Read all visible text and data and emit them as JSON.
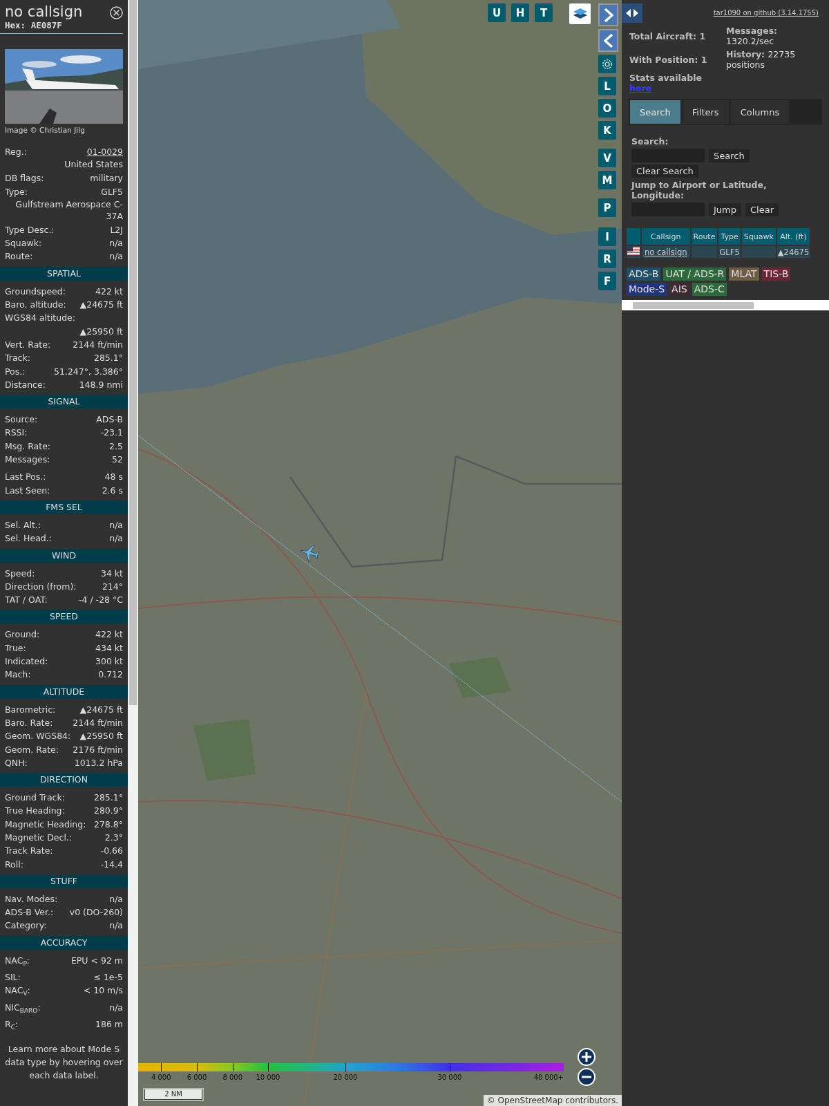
{
  "detail": {
    "callsign": "no callsign",
    "hex": "Hex: AE087F",
    "photo_credit": "Image © Christian Jilg",
    "rows": [
      {
        "label": "Reg.:",
        "value": "01-0029",
        "kind": "link"
      },
      {
        "value": "United States",
        "kind": "value_only"
      },
      {
        "label": "DB flags:",
        "value": "military",
        "kind": "pair"
      },
      {
        "label": "Type:",
        "value": "GLF5",
        "kind": "pair"
      },
      {
        "value": "Gulfstream Aerospace C-37A",
        "kind": "value_only"
      },
      {
        "label": "Type Desc.:",
        "value": "L2J",
        "kind": "pair"
      },
      {
        "label": "Squawk:",
        "value": "n/a",
        "kind": "pair"
      },
      {
        "label": "Route:",
        "value": "n/a",
        "kind": "pair"
      }
    ],
    "sections": [
      {
        "title": "SPATIAL",
        "groups": [
          [
            {
              "label": "Groundspeed:",
              "value": "422 kt",
              "kind": "pair"
            },
            {
              "label": "Baro. altitude:",
              "value": "▲24675 ft",
              "kind": "pair"
            },
            {
              "label": "WGS84 altitude:",
              "value": "▲25950 ft",
              "kind": "stacked"
            },
            {
              "label": "Vert. Rate:",
              "value": "2144 ft/min",
              "kind": "pair"
            },
            {
              "label": "Track:",
              "value": "285.1°",
              "kind": "pair"
            },
            {
              "label": "Pos.:",
              "value": "51.247°, 3.386°",
              "kind": "pair"
            },
            {
              "label": "Distance:",
              "value": "148.9 nmi",
              "kind": "pair"
            }
          ]
        ]
      },
      {
        "title": "SIGNAL",
        "groups": [
          [
            {
              "label": "Source:",
              "value": "ADS-B",
              "kind": "pair"
            },
            {
              "label": "RSSI:",
              "value": "-23.1",
              "kind": "pair"
            },
            {
              "label": "Msg. Rate:",
              "value": "2.5",
              "kind": "pair"
            },
            {
              "label": "Messages:",
              "value": "52",
              "kind": "pair"
            }
          ],
          [
            {
              "label": "Last Pos.:",
              "value": "48 s",
              "kind": "pair"
            },
            {
              "label": "Last Seen:",
              "value": "2.6 s",
              "kind": "pair"
            }
          ]
        ]
      },
      {
        "title": "FMS SEL",
        "groups": [
          [
            {
              "label": "Sel. Alt.:",
              "value": "n/a",
              "kind": "pair"
            },
            {
              "label": "Sel. Head.:",
              "value": "n/a",
              "kind": "pair"
            }
          ]
        ]
      },
      {
        "title": "WIND",
        "groups": [
          [
            {
              "label": "Speed:",
              "value": "34 kt",
              "kind": "pair"
            },
            {
              "label": "Direction (from):",
              "value": "214°",
              "kind": "pair"
            },
            {
              "label": "TAT / OAT:",
              "value": "-4 / -28 °C",
              "kind": "pair"
            }
          ]
        ]
      },
      {
        "title": "SPEED",
        "groups": [
          [
            {
              "label": "Ground:",
              "value": "422 kt",
              "kind": "pair"
            },
            {
              "label": "True:",
              "value": "434 kt",
              "kind": "pair"
            },
            {
              "label": "Indicated:",
              "value": "300 kt",
              "kind": "pair"
            },
            {
              "label": "Mach:",
              "value": "0.712",
              "kind": "pair"
            }
          ]
        ]
      },
      {
        "title": "ALTITUDE",
        "groups": [
          [
            {
              "label": "Barometric:",
              "value": "▲24675 ft",
              "kind": "pair"
            },
            {
              "label": "Baro. Rate:",
              "value": "2144 ft/min",
              "kind": "pair"
            },
            {
              "label": "Geom. WGS84:",
              "value": "▲25950 ft",
              "kind": "pair"
            },
            {
              "label": "Geom. Rate:",
              "value": "2176 ft/min",
              "kind": "pair"
            },
            {
              "label": "QNH:",
              "value": "1013.2 hPa",
              "kind": "pair"
            }
          ]
        ]
      },
      {
        "title": "DIRECTION",
        "groups": [
          [
            {
              "label": "Ground Track:",
              "value": "285.1°",
              "kind": "pair"
            },
            {
              "label": "True Heading:",
              "value": "280.9°",
              "kind": "pair"
            },
            {
              "label": "Magnetic Heading:",
              "value": "278.8°",
              "kind": "pair"
            },
            {
              "label": "Magnetic Decl.:",
              "value": "2.3°",
              "kind": "pair"
            },
            {
              "label": "Track Rate:",
              "value": "-0.66",
              "kind": "pair"
            },
            {
              "label": "Roll:",
              "value": "-14.4",
              "kind": "pair"
            }
          ]
        ]
      },
      {
        "title": "STUFF",
        "groups": [
          [
            {
              "label": "Nav. Modes:",
              "value": "n/a",
              "kind": "pair"
            },
            {
              "label": "ADS-B Ver.:",
              "value": "v0 (DO-260)",
              "kind": "pair"
            },
            {
              "label": "Category:",
              "value": "n/a",
              "kind": "pair"
            }
          ]
        ]
      },
      {
        "title": "ACCURACY",
        "groups": [
          [
            {
              "label": "NAC$_{P}$:",
              "value": "EPU < 92 m",
              "kind": "pair"
            },
            {
              "label": "SIL:",
              "value": "≤ 1e-5",
              "kind": "pair"
            },
            {
              "label": "NAC$_{V}$:",
              "value": "< 10 m/s",
              "kind": "pair"
            },
            {
              "label": "NIC$_{BARO}$:",
              "value": "n/a",
              "kind": "pair"
            },
            {
              "label": "R$_{C}$:",
              "value": "186 m",
              "kind": "pair"
            }
          ]
        ]
      }
    ],
    "footer": "Learn more about Mode S data type by hovering over each data label."
  },
  "map": {
    "kind": "picture",
    "top_buttons": [
      "U",
      "H",
      "T"
    ],
    "side_buttons": [
      {
        "kind": "next"
      },
      {
        "kind": "prev"
      },
      {
        "kind": "settings"
      },
      {
        "kind": "letter",
        "label": "L"
      },
      {
        "kind": "letter",
        "label": "O"
      },
      {
        "kind": "letter",
        "label": "K"
      },
      {
        "kind": "letter",
        "label": "V"
      },
      {
        "kind": "letter",
        "label": "M"
      },
      {
        "kind": "letter",
        "label": "P"
      },
      {
        "kind": "letter",
        "label": "I"
      },
      {
        "kind": "letter",
        "label": "R"
      },
      {
        "kind": "letter",
        "label": "F"
      }
    ],
    "legend": {
      "labels": [
        "4 000",
        "6 000",
        "8 000",
        "10 000",
        "20 000",
        "30 000",
        "40 000+"
      ]
    },
    "scale": "2 NM",
    "attribution": {
      "prefix": "©",
      "link": "OpenStreetMap",
      "suffix": "contributors."
    }
  },
  "sidebar": {
    "version_link": "tar1090 on github (3.14.1755)",
    "stats": {
      "total": "Total Aircraft: 1",
      "messages_label": "Messages:",
      "messages": "1320.2/sec",
      "with_position": "With Position: 1",
      "history_label": "History:",
      "history": "22735 positions",
      "stats_label": "Stats available",
      "stats_link": "here"
    },
    "tabs": [
      {
        "label": "Search",
        "selected": true
      },
      {
        "label": "Filters",
        "selected": false
      },
      {
        "label": "Columns",
        "selected": false
      }
    ],
    "search": {
      "label": "Search:",
      "button": "Search",
      "clear_button": "Clear Search",
      "jump_label": "Jump to Airport or Latitude, Longitude:",
      "jump_button": "Jump",
      "clear_jump_button": "Clear"
    },
    "table": {
      "columns": [
        "Callsign",
        "Route",
        "Type",
        "Squawk",
        "Alt. (ft)"
      ],
      "rows": [
        {
          "callsign": "no callsign",
          "type": "GLF5",
          "altitude": "▲24675"
        }
      ]
    },
    "sources": [
      {
        "label": "ADS-B",
        "color": "#1f4f66"
      },
      {
        "label": "UAT / ADS-R",
        "color": "#2c6a3c"
      },
      {
        "label": "MLAT",
        "color": "#6e5c44"
      },
      {
        "label": "TIS-B",
        "color": "#6c2638"
      },
      {
        "label": "Mode-S",
        "color": "#22357e"
      },
      {
        "label": "AIS",
        "color": "#3e2a30"
      },
      {
        "label": "ADS-C",
        "color": "#2c6a3c"
      }
    ]
  }
}
